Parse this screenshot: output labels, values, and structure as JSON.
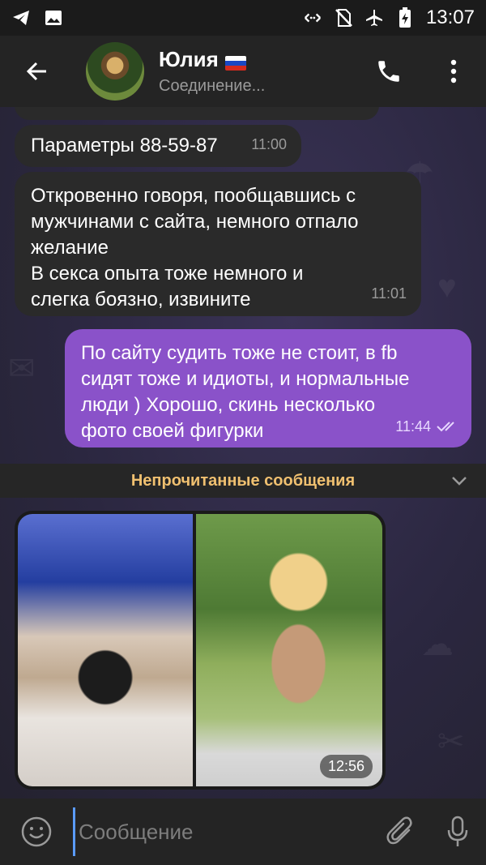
{
  "status_bar": {
    "time": "13:07",
    "left_icons": [
      "telegram-icon",
      "gallery-icon"
    ],
    "right_icons": [
      "data-saver-icon",
      "no-sim-icon",
      "airplane-icon",
      "battery-charging-icon"
    ]
  },
  "header": {
    "contact_name": "Юлия",
    "status": "Соединение..."
  },
  "messages": [
    {
      "direction": "in",
      "text": "Параметры 88-59-87",
      "time": "11:00"
    },
    {
      "direction": "in",
      "lines": [
        "Откровенно говоря, пообщавшись с",
        "мужчинами с сайта, немного отпало",
        "желание",
        "В секса опыта тоже немного и",
        "слегка боязно, извините"
      ],
      "time": "11:01"
    },
    {
      "direction": "out",
      "lines": [
        "По сайту судить тоже не стоит, в fb",
        "сидят тоже и идиоты, и нормальные",
        "люди ) Хорошо, скинь несколько",
        "фото своей фигурки"
      ],
      "time": "11:44",
      "read": true
    }
  ],
  "unread_divider": "Непрочитанные сообщения",
  "photo_message": {
    "time": "12:56",
    "photo_count": 2
  },
  "input": {
    "placeholder": "Сообщение"
  },
  "colors": {
    "outgoing_bubble": "#8a52c9",
    "incoming_bubble": "#2a2a2a",
    "unread_text": "#f0c070"
  }
}
